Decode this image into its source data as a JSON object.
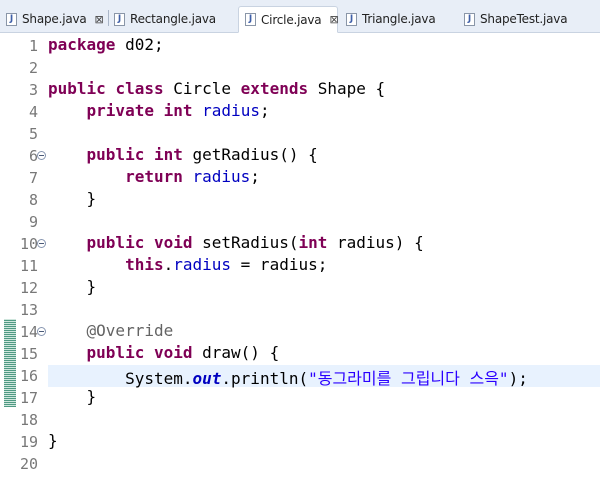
{
  "tabs": [
    {
      "label": "Shape.java",
      "close": "⊠"
    },
    {
      "label": "Rectangle.java"
    },
    {
      "label": "Circle.java",
      "close": "⊠"
    },
    {
      "label": "Triangle.java"
    },
    {
      "label": "ShapeTest.java"
    }
  ],
  "active_tab": "Circle.java",
  "colors": {
    "keyword": "#7f0055",
    "field": "#0000c0",
    "string": "#2a00ff",
    "annotation": "#646464",
    "current_line": "#e8f2fe",
    "change_marker": "#4f9a83"
  },
  "icons": {
    "file": "java-file-icon",
    "fold": "fold-collapse-icon"
  },
  "editor": {
    "line_numbers": [
      "1",
      "2",
      "3",
      "4",
      "5",
      "6",
      "7",
      "8",
      "9",
      "10",
      "11",
      "12",
      "13",
      "14",
      "15",
      "16",
      "17",
      "18",
      "19",
      "20"
    ],
    "current_line": 16,
    "code": {
      "l1": {
        "kw": "package",
        "rest": " d02;"
      },
      "l3": {
        "kw1": "public",
        "kw2": "class",
        "name": " Circle ",
        "kw3": "extends",
        "rest": " Shape {"
      },
      "l4": {
        "kw1": "private",
        "kw2": "int",
        "field": "radius",
        "rest": ";"
      },
      "l6": {
        "kw1": "public",
        "kw2": "int",
        "rest": " getRadius() {"
      },
      "l7": {
        "kw": "return",
        "field": "radius",
        "rest": ";"
      },
      "l8": {
        "text": "}"
      },
      "l10": {
        "kw1": "public",
        "kw2": "void",
        "mid": " setRadius(",
        "kw3": "int",
        "rest": " radius) {"
      },
      "l11": {
        "kw": "this",
        "dot": ".",
        "field": "radius",
        "rest": " = radius;"
      },
      "l12": {
        "text": "}"
      },
      "l14": {
        "annotation": "@Override"
      },
      "l15": {
        "kw1": "public",
        "kw2": "void",
        "rest": " draw() {"
      },
      "l16": {
        "pre": "System.",
        "static": "out",
        "mid": ".println(",
        "string": "\"동그라미를 그립니다 스윽\"",
        "rest": ");"
      },
      "l17": {
        "text": "}"
      },
      "l19": {
        "text": "}"
      }
    }
  }
}
